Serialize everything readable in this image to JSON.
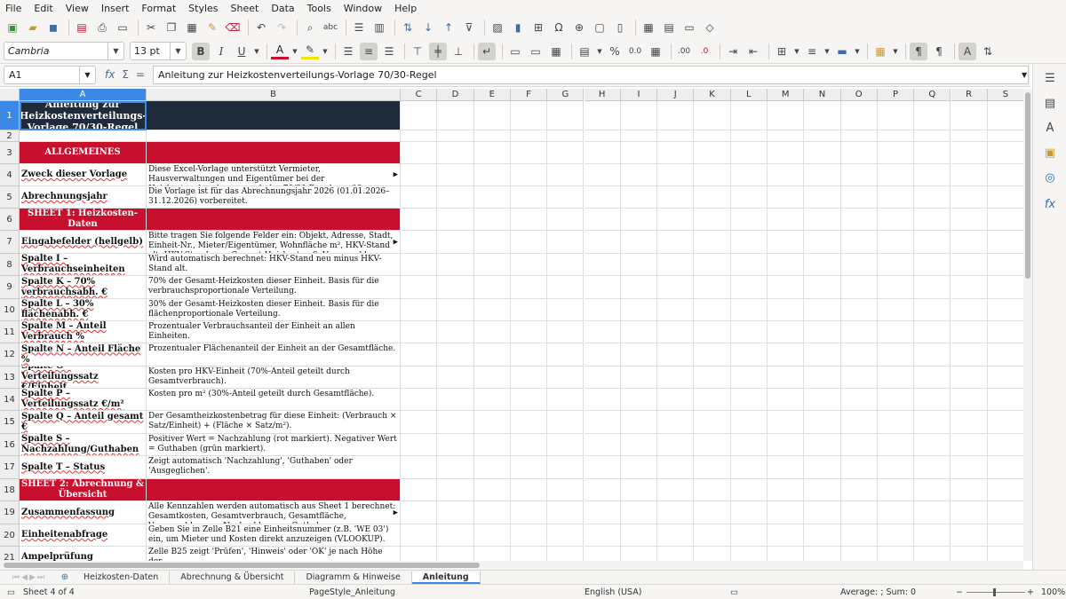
{
  "menu": [
    "File",
    "Edit",
    "View",
    "Insert",
    "Format",
    "Styles",
    "Sheet",
    "Data",
    "Tools",
    "Window",
    "Help"
  ],
  "toolbar": {
    "font_name": "Cambria",
    "font_size": "13 pt",
    "bold_label": "B",
    "italic_label": "I",
    "underline_label": "U",
    "font_color_label": "A",
    "percent_label": "%",
    "zero_decimals_label": "0.0",
    "add_decimal_label": ".00",
    "del_decimal_label": ".0"
  },
  "formula_bar": {
    "cell_ref": "A1",
    "content": "Anleitung zur Heizkostenverteilungs-Vorlage 70/30-Regel",
    "fx": "fx",
    "sigma": "Σ",
    "equals": "="
  },
  "columns": [
    "A",
    "B",
    "C",
    "D",
    "E",
    "F",
    "G",
    "H",
    "I",
    "J",
    "K",
    "L",
    "M",
    "N",
    "O",
    "P",
    "Q",
    "R",
    "S"
  ],
  "rows": [
    "1",
    "2",
    "3",
    "4",
    "5",
    "6",
    "7",
    "8",
    "9",
    "10",
    "11",
    "12",
    "13",
    "14",
    "15",
    "16",
    "17",
    "18",
    "19",
    "20",
    "21"
  ],
  "sheet": {
    "r1": {
      "a": "Anleitung zur Heizkostenverteilungs-Vorlage 70/30-Regel"
    },
    "r3": {
      "a": "ALLGEMEINES"
    },
    "r4": {
      "a": "Zweck dieser Vorlage",
      "b": "Diese Excel-Vorlage unterstützt Vermieter, Hausverwaltungen und Eigentümer bei der Heizkostenabrechnung nach der 70/30-Regel gemäß Heizkostenverordnung (HeizkostenV)."
    },
    "r5": {
      "a": "Abrechnungsjahr",
      "b": "Die Vorlage ist für das Abrechnungsjahr 2026 (01.01.2026–31.12.2026) vorbereitet."
    },
    "r6": {
      "a": "SHEET 1: Heizkosten-Daten"
    },
    "r7": {
      "a": "Eingabefelder (hellgelb)",
      "b": "Bitte tragen Sie folgende Felder ein: Objekt, Adresse, Stadt, Einheit-Nr., Mieter/Eigentümer, Wohnfläche m², HKV-Stand alt, HKV-Stand neu, Gesamt-Heizkosten €, Vorauszahlungen €."
    },
    "r8": {
      "a": "Spalte I – Verbrauchseinheiten",
      "b": "Wird automatisch berechnet: HKV-Stand neu minus HKV-Stand alt."
    },
    "r9": {
      "a": "Spalte K – 70% verbrauchsabh. €",
      "b": "70% der Gesamt-Heizkosten dieser Einheit. Basis für die verbrauchsproportionale Verteilung."
    },
    "r10": {
      "a": "Spalte L – 30% flächenabh. €",
      "b": "30% der Gesamt-Heizkosten dieser Einheit. Basis für die flächenproportionale Verteilung."
    },
    "r11": {
      "a": "Spalte M – Anteil Verbrauch %",
      "b": "Prozentualer Verbrauchsanteil der Einheit an allen Einheiten."
    },
    "r12": {
      "a": "Spalte N – Anteil Fläche %",
      "b": "Prozentualer Flächenanteil der Einheit an der Gesamtfläche."
    },
    "r13": {
      "a": "Spalte O – Verteilungssatz €/Einheit",
      "b": "Kosten pro HKV-Einheit (70%-Anteil geteilt durch Gesamtverbrauch)."
    },
    "r14": {
      "a": "Spalte P – Verteilungssatz €/m²",
      "b": "Kosten pro m² (30%-Anteil geteilt durch Gesamtfläche)."
    },
    "r15": {
      "a": "Spalte Q – Anteil gesamt €",
      "b": "Der Gesamtheizkostenbetrag für diese Einheit: (Verbrauch × Satz/Einheit) + (Fläche × Satz/m²)."
    },
    "r16": {
      "a": "Spalte S – Nachzahlung/Guthaben",
      "b": "Positiver Wert = Nachzahlung (rot markiert). Negativer Wert = Guthaben (grün markiert)."
    },
    "r17": {
      "a": "Spalte T – Status",
      "b": "Zeigt automatisch 'Nachzahlung', 'Guthaben' oder 'Ausgeglichen'."
    },
    "r18": {
      "a": "SHEET 2: Abrechnung & Übersicht"
    },
    "r19": {
      "a": "Zusammenfassung",
      "b": "Alle Kennzahlen werden automatisch aus Sheet 1 berechnet: Gesamtkosten, Gesamtverbrauch, Gesamtfläche, Vorauszahlungen, Nachzahlungen, Guthaben."
    },
    "r20": {
      "a": "Einheitenabfrage",
      "b": "Geben Sie in Zelle B21 eine Einheitsnummer (z.B. 'WE 03') ein, um Mieter und Kosten direkt anzuzeigen (VLOOKUP)."
    },
    "r21": {
      "a": "Ampelprüfung",
      "b": "Zelle B25 zeigt 'Prüfen', 'Hinweis' oder 'OK' je nach Höhe der"
    }
  },
  "tabs": [
    "Heizkosten-Daten",
    "Abrechnung & Übersicht",
    "Diagramm & Hinweise",
    "Anleitung"
  ],
  "status": {
    "sheet": "Sheet 4 of 4",
    "page_style": "PageStyle_Anleitung",
    "language": "English (USA)",
    "summary": "Average: ; Sum: 0",
    "zoom": "100%"
  },
  "colors": {
    "section_red": "#c8102e",
    "title_navy": "#1f2a3a",
    "selection_blue": "#3b88e6"
  }
}
